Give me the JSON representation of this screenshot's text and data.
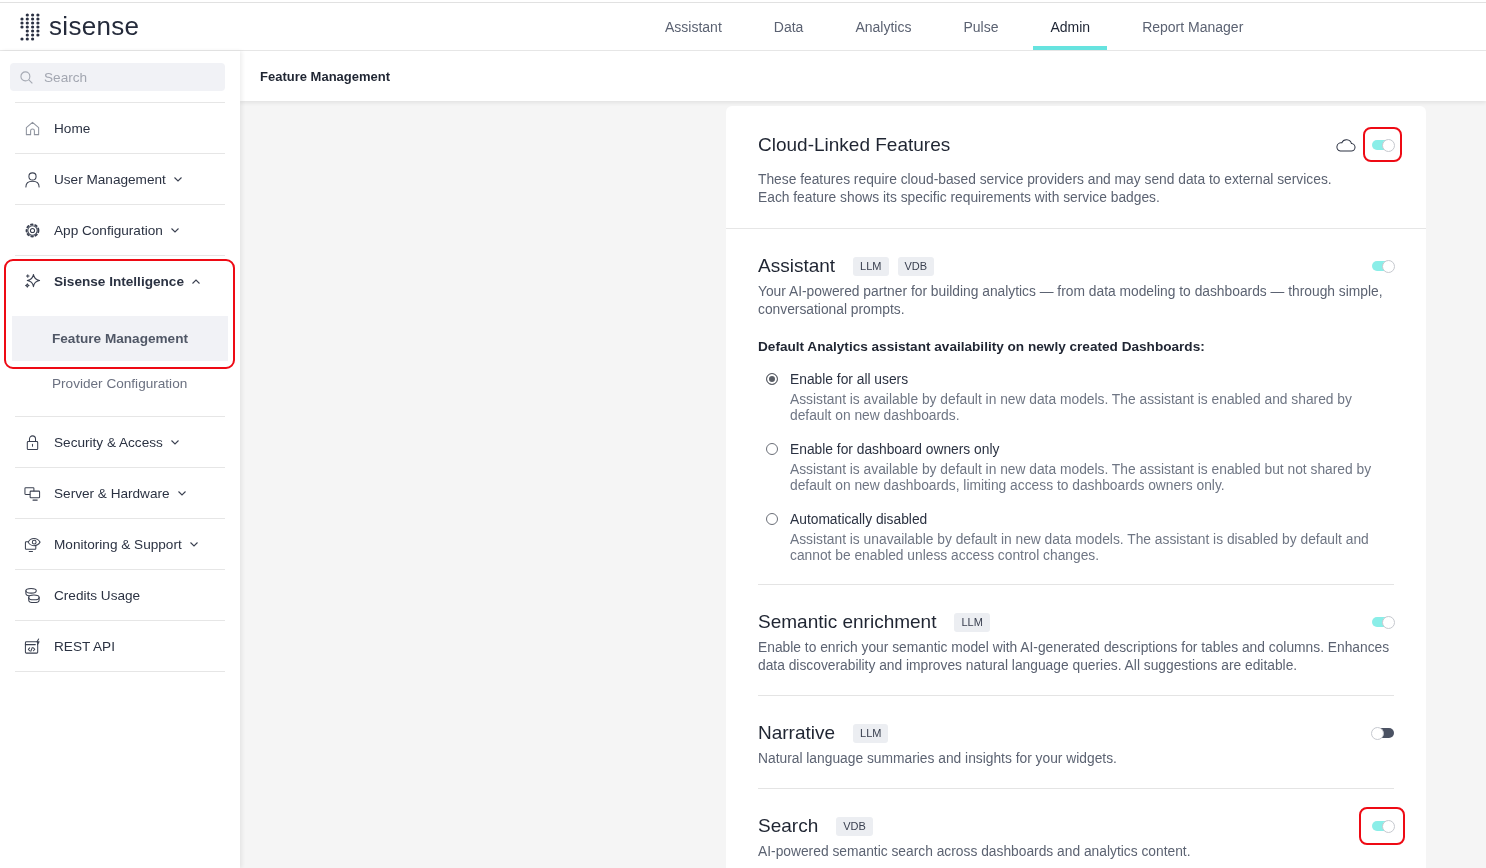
{
  "logo": {
    "text": "sisense"
  },
  "nav_tabs": [
    {
      "label": "Assistant",
      "selected": false
    },
    {
      "label": "Data",
      "selected": false
    },
    {
      "label": "Analytics",
      "selected": false
    },
    {
      "label": "Pulse",
      "selected": false
    },
    {
      "label": "Admin",
      "selected": true
    },
    {
      "label": "Report Manager",
      "selected": false
    }
  ],
  "sidebar": {
    "search": {
      "placeholder": "Search"
    },
    "items": [
      {
        "label": "Home",
        "kind": "link",
        "highlighted": false
      },
      {
        "label": "User Management",
        "kind": "group",
        "expanded": false,
        "highlighted": false
      },
      {
        "label": "App Configuration",
        "kind": "group",
        "expanded": false,
        "highlighted": false
      },
      {
        "label": "Sisense Intelligence",
        "kind": "group",
        "expanded": true,
        "highlighted": true,
        "children": [
          {
            "label": "Feature Management",
            "selected": true,
            "highlighted": true
          },
          {
            "label": "Provider Configuration",
            "selected": false,
            "highlighted": false
          }
        ]
      },
      {
        "label": "Security & Access",
        "kind": "group",
        "expanded": false,
        "highlighted": false
      },
      {
        "label": "Server & Hardware",
        "kind": "group",
        "expanded": false,
        "highlighted": false
      },
      {
        "label": "Monitoring & Support",
        "kind": "group",
        "expanded": false,
        "highlighted": false
      },
      {
        "label": "Credits Usage",
        "kind": "link",
        "highlighted": false
      },
      {
        "label": "REST API",
        "kind": "link",
        "highlighted": false
      }
    ]
  },
  "page_header": {
    "title": "Feature Management"
  },
  "cloud_section": {
    "title": "Cloud-Linked Features",
    "description": [
      "These features require cloud-based service providers and may send data to external services.",
      "Each feature shows its specific requirements with service badges."
    ],
    "on": true,
    "highlighted": true
  },
  "features": [
    {
      "name": "Assistant",
      "badges": [
        "LLM",
        "VDB"
      ],
      "on": true,
      "highlighted": false,
      "description": "Your AI-powered partner for building analytics — from data modeling to dashboards — through simple, conversational prompts.",
      "setting": {
        "heading": "Default Analytics assistant availability on newly created Dashboards:",
        "options": [
          {
            "label": "Enable for all users",
            "selected": true,
            "description": "Assistant is available by default in new data models. The assistant is enabled and shared by default on new dashboards."
          },
          {
            "label": "Enable for dashboard owners only",
            "selected": false,
            "description": "Assistant is available by default in new data models. The assistant is enabled but not shared by default on new dashboards, limiting access to dashboards owners only."
          },
          {
            "label": "Automatically disabled",
            "selected": false,
            "description": "Assistant is unavailable by default in new data models. The assistant is disabled by default and cannot be enabled unless access control changes."
          }
        ]
      }
    },
    {
      "name": "Semantic enrichment",
      "badges": [
        "LLM"
      ],
      "on": true,
      "highlighted": false,
      "description": "Enable to enrich your semantic model with AI-generated descriptions for tables and columns. Enhances data discoverability and improves natural language queries. All suggestions are editable."
    },
    {
      "name": "Narrative",
      "badges": [
        "LLM"
      ],
      "on": false,
      "highlighted": false,
      "description": "Natural language summaries and insights for your widgets."
    },
    {
      "name": "Search",
      "badges": [
        "VDB"
      ],
      "on": true,
      "highlighted": true,
      "description": "AI-powered semantic search across dashboards and analytics content."
    }
  ]
}
